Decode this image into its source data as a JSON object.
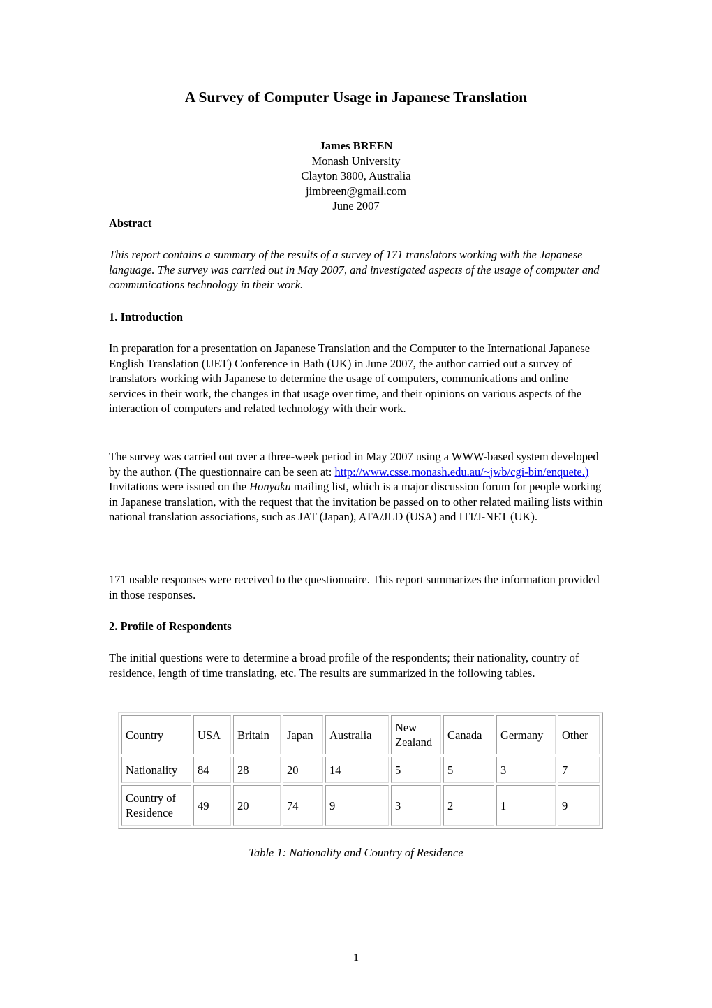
{
  "title": "A Survey of Computer Usage in Japanese Translation",
  "author": {
    "name": "James BREEN",
    "affiliation": "Monash University",
    "address": "Clayton 3800, Australia",
    "email": "jimbreen@gmail.com",
    "date": "June 2007"
  },
  "abstract": {
    "heading": "Abstract",
    "text": "This report contains a summary of the results of a survey of 171 translators working with the Japanese language. The survey was carried out in May 2007, and investigated aspects of the usage of computer and communications technology in their work."
  },
  "section1": {
    "heading": "1. Introduction",
    "para1": "In preparation for a presentation on Japanese Translation and the Computer to the International Japanese English Translation (IJET) Conference in Bath (UK) in June 2007, the author carried out a survey of translators working with Japanese to determine the usage of computers, communications and online services in their work, the changes in that usage over time, and their opinions on various aspects of the interaction of computers and related technology with their work.",
    "para2_before_link": "The survey was carried out over a three-week period in May 2007 using a WWW-based system developed by the author. (The questionnaire can be seen at: ",
    "para2_link": "http://www.csse.monash.edu.au/~jwb/cgi-bin/enquete.) ",
    "para2_after_link": "Invitations were issued on the ",
    "para2_italic": "Honyaku",
    "para2_rest": " mailing list, which is a major discussion forum for people working in Japanese translation, with the request that the invitation be passed on to other related mailing lists within national translation associations, such as JAT (Japan), ATA/JLD (USA) and ITI/J-NET (UK).",
    "para3": "171 usable responses were received to the questionnaire. This report summarizes the information provided in those responses."
  },
  "section2": {
    "heading": "2. Profile of Respondents",
    "para1": "The initial questions were to determine a broad profile of the respondents; their nationality, country of residence, length of time translating, etc. The results are summarized in the following tables."
  },
  "table1": {
    "header": [
      "Country",
      "USA",
      "Britain",
      "Japan",
      "Australia",
      "New Zealand",
      "Canada",
      "Germany",
      "Other"
    ],
    "rows": [
      [
        "Nationality",
        "84",
        "28",
        "20",
        "14",
        "5",
        "5",
        "3",
        "7"
      ],
      [
        "Country of Residence",
        "49",
        "20",
        "74",
        "9",
        "3",
        "2",
        "1",
        "9"
      ]
    ],
    "caption": "Table 1: Nationality and Country of Residence"
  },
  "page_number": "1"
}
